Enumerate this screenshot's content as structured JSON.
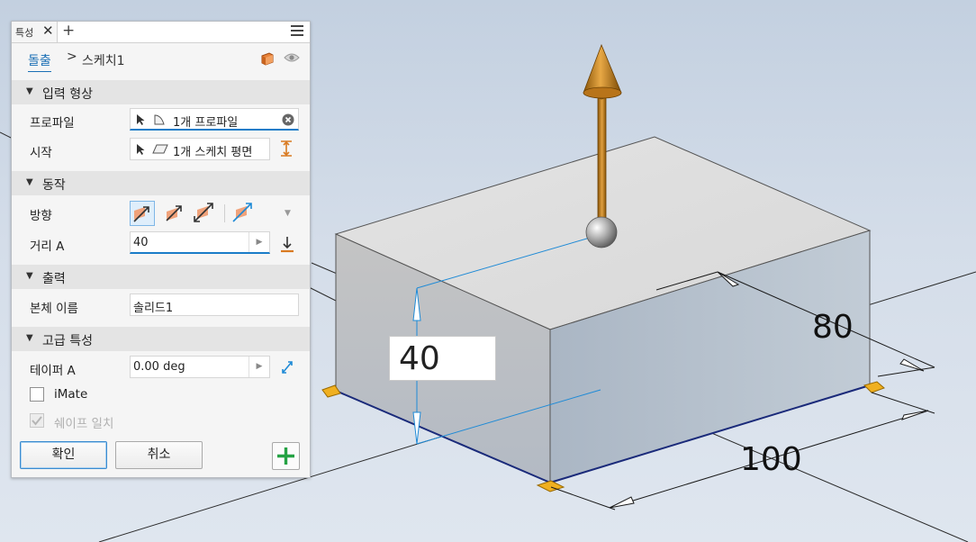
{
  "panel": {
    "tab_label": "특성",
    "tab_close": "✕",
    "tab_add": "+",
    "breadcrumb": {
      "parent": "돌출",
      "separator": ">",
      "current": "스케치1"
    },
    "sections": {
      "input": "입력 형상",
      "behavior": "동작",
      "output": "출력",
      "advanced": "고급 특성"
    },
    "rows": {
      "profile_label": "프로파일",
      "profile_value": "1개 프로파일",
      "start_label": "시작",
      "start_value": "1개 스케치 평면",
      "direction_label": "방향",
      "distance_label": "거리 A",
      "distance_value": "40",
      "body_name_label": "본체 이름",
      "body_name_value": "솔리드1",
      "taper_label": "테이퍼 A",
      "taper_value": "0.00 deg",
      "imate_label": "iMate",
      "match_shape_label": "쉐이프 일치"
    },
    "buttons": {
      "ok": "확인",
      "cancel": "취소"
    }
  },
  "viewport": {
    "dim_height": "40",
    "dim_depth": "80",
    "dim_width": "100",
    "colors": {
      "arrow": "#c27c10",
      "dimension_line": "#1e8ad6",
      "edge": "#1a2a7a",
      "marker": "#f0b020"
    }
  }
}
